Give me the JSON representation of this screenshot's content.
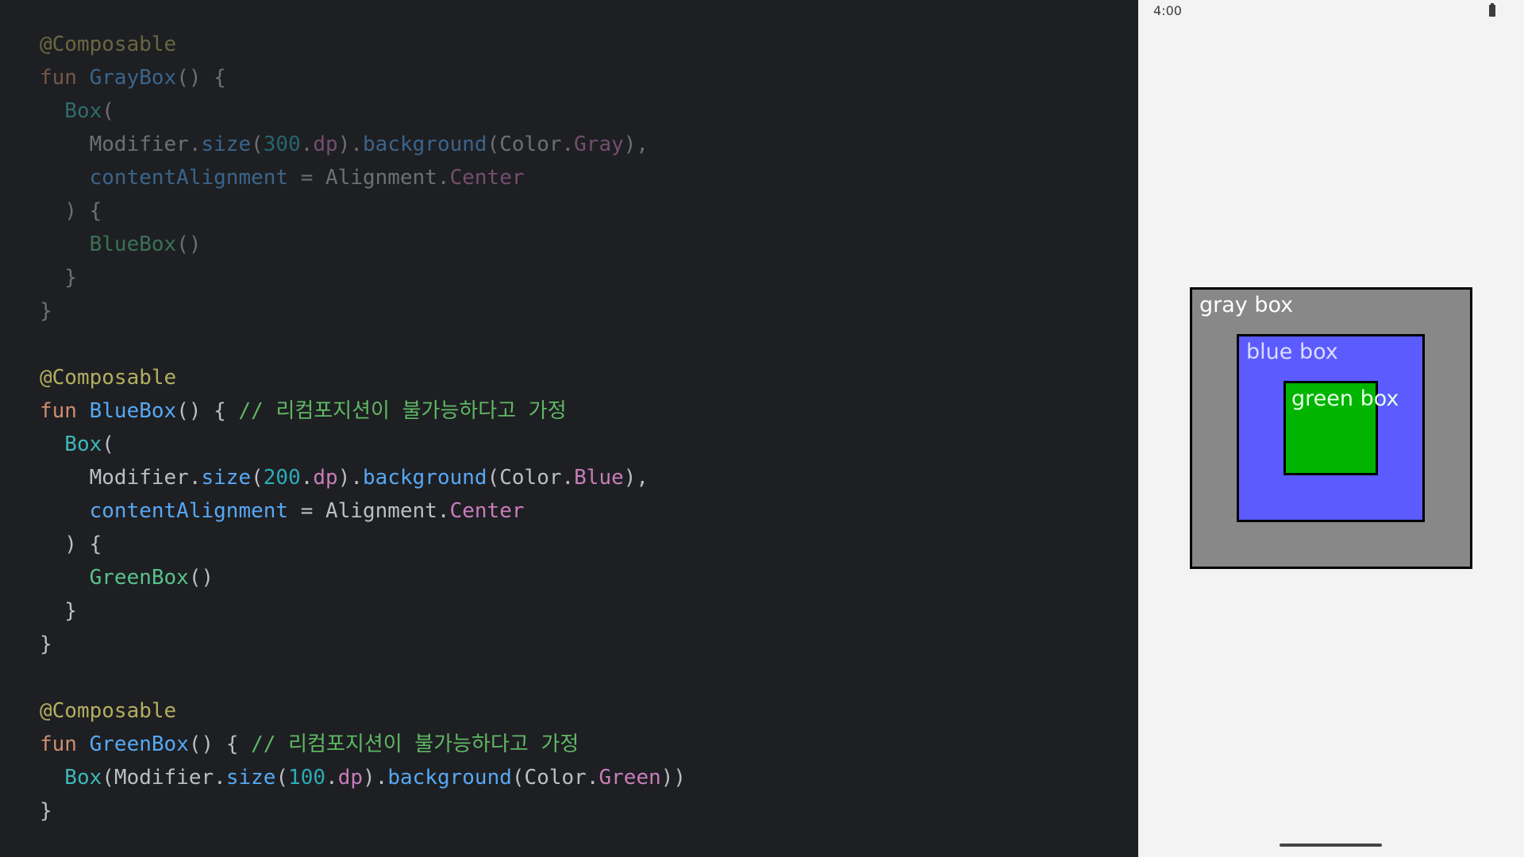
{
  "editor": {
    "code_lines": [
      [
        {
          "t": "@Composable",
          "c": "ann"
        }
      ],
      [
        {
          "t": "fun ",
          "c": "kw"
        },
        {
          "t": "GrayBox",
          "c": "fn"
        },
        {
          "t": "() {",
          "c": "op"
        }
      ],
      [
        {
          "t": "  Box",
          "c": "fnc"
        },
        {
          "t": "(",
          "c": "op"
        }
      ],
      [
        {
          "t": "    Modifier.",
          "c": "op"
        },
        {
          "t": "size",
          "c": "fn"
        },
        {
          "t": "(",
          "c": "op"
        },
        {
          "t": "300",
          "c": "num"
        },
        {
          "t": ".",
          "c": "op"
        },
        {
          "t": "dp",
          "c": "prop"
        },
        {
          "t": ").",
          "c": "op"
        },
        {
          "t": "background",
          "c": "fn"
        },
        {
          "t": "(Color.",
          "c": "op"
        },
        {
          "t": "Gray",
          "c": "prop"
        },
        {
          "t": "),",
          "c": "op"
        }
      ],
      [
        {
          "t": "    contentAlignment",
          "c": "prm"
        },
        {
          "t": " = Alignment.",
          "c": "op"
        },
        {
          "t": "Center",
          "c": "prop"
        }
      ],
      [
        {
          "t": "  ) {",
          "c": "op"
        }
      ],
      [
        {
          "t": "    BlueBox",
          "c": "fng"
        },
        {
          "t": "()",
          "c": "op"
        }
      ],
      [
        {
          "t": "  }",
          "c": "op"
        }
      ],
      [
        {
          "t": "}",
          "c": "op"
        }
      ],
      [],
      [
        {
          "t": "@Composable",
          "c": "ann"
        }
      ],
      [
        {
          "t": "fun ",
          "c": "kw"
        },
        {
          "t": "BlueBox",
          "c": "fn"
        },
        {
          "t": "() { ",
          "c": "op"
        },
        {
          "t": "// 리컴포지션이 불가능하다고 가정",
          "c": "cmt"
        }
      ],
      [
        {
          "t": "  Box",
          "c": "fnc"
        },
        {
          "t": "(",
          "c": "op"
        }
      ],
      [
        {
          "t": "    Modifier.",
          "c": "op"
        },
        {
          "t": "size",
          "c": "fn"
        },
        {
          "t": "(",
          "c": "op"
        },
        {
          "t": "200",
          "c": "num"
        },
        {
          "t": ".",
          "c": "op"
        },
        {
          "t": "dp",
          "c": "prop"
        },
        {
          "t": ").",
          "c": "op"
        },
        {
          "t": "background",
          "c": "fn"
        },
        {
          "t": "(Color.",
          "c": "op"
        },
        {
          "t": "Blue",
          "c": "prop"
        },
        {
          "t": "),",
          "c": "op"
        }
      ],
      [
        {
          "t": "    contentAlignment",
          "c": "prm"
        },
        {
          "t": " = Alignment.",
          "c": "op"
        },
        {
          "t": "Center",
          "c": "prop"
        }
      ],
      [
        {
          "t": "  ) {",
          "c": "op"
        }
      ],
      [
        {
          "t": "    GreenBox",
          "c": "fng"
        },
        {
          "t": "()",
          "c": "op"
        }
      ],
      [
        {
          "t": "  }",
          "c": "op"
        }
      ],
      [
        {
          "t": "}",
          "c": "op"
        }
      ],
      [],
      [
        {
          "t": "@Composable",
          "c": "ann"
        }
      ],
      [
        {
          "t": "fun ",
          "c": "kw"
        },
        {
          "t": "GreenBox",
          "c": "fn"
        },
        {
          "t": "() { ",
          "c": "op"
        },
        {
          "t": "// 리컴포지션이 불가능하다고 가정",
          "c": "cmt"
        }
      ],
      [
        {
          "t": "  Box",
          "c": "fnc"
        },
        {
          "t": "(Modifier.",
          "c": "op"
        },
        {
          "t": "size",
          "c": "fn"
        },
        {
          "t": "(",
          "c": "op"
        },
        {
          "t": "100",
          "c": "num"
        },
        {
          "t": ".",
          "c": "op"
        },
        {
          "t": "dp",
          "c": "prop"
        },
        {
          "t": ").",
          "c": "op"
        },
        {
          "t": "background",
          "c": "fn"
        },
        {
          "t": "(Color.",
          "c": "op"
        },
        {
          "t": "Green",
          "c": "prop"
        },
        {
          "t": "))",
          "c": "op"
        }
      ],
      [
        {
          "t": "}",
          "c": "op"
        }
      ]
    ],
    "dimmed_lines": [
      0,
      1,
      2,
      3,
      4,
      5,
      6,
      7,
      8
    ]
  },
  "device": {
    "status_time": "4:00",
    "gray_box_label": "gray box",
    "blue_box_label": "blue box",
    "green_box_label": "green box"
  }
}
